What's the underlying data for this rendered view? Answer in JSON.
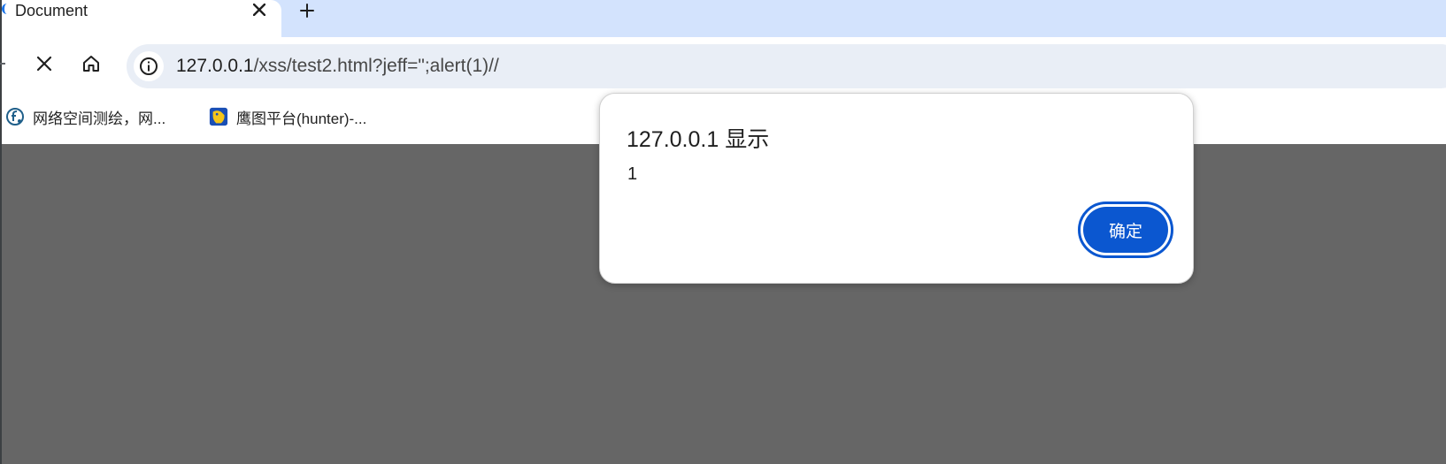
{
  "tab": {
    "title": "Document"
  },
  "toolbar": {
    "url_host": "127.0.0.1",
    "url_path": "/xss/test2.html?jeff=\";alert(1)//"
  },
  "bookmarks": [
    {
      "label": "网络空间测绘，网...",
      "icon": "fofa-icon"
    },
    {
      "label": "鹰图平台(hunter)-...",
      "icon": "hunter-icon"
    }
  ],
  "dialog": {
    "title": "127.0.0.1 显示",
    "message": "1",
    "ok_label": "确定"
  },
  "colors": {
    "tabstrip": "#d3e3fd",
    "omnibox": "#e9eef6",
    "overlay": "#666666",
    "primary_button": "#0b57d0"
  }
}
